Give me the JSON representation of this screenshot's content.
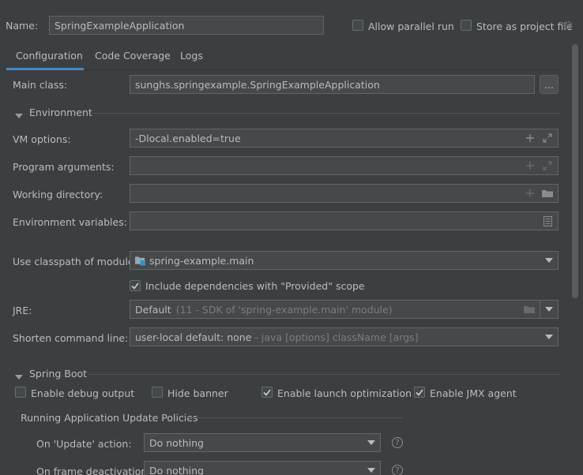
{
  "header": {
    "name_label": "Name:",
    "name_value": "SpringExampleApplication",
    "allow_parallel_label": "Allow parallel run",
    "store_project_label": "Store as project file"
  },
  "tabs": [
    {
      "label": "Configuration",
      "active": true
    },
    {
      "label": "Code Coverage",
      "active": false
    },
    {
      "label": "Logs",
      "active": false
    }
  ],
  "config": {
    "main_class_label": "Main class:",
    "main_class_value": "sunghs.springexample.SpringExampleApplication",
    "browse_label": "...",
    "environment_label": "Environment",
    "vm_options_label": "VM options:",
    "vm_options_value": "-Dlocal.enabled=true",
    "program_args_label": "Program arguments:",
    "program_args_value": "",
    "working_dir_label": "Working directory:",
    "working_dir_value": "",
    "env_vars_label": "Environment variables:",
    "env_vars_value": "",
    "classpath_label": "Use classpath of module:",
    "classpath_value": "spring-example.main",
    "include_deps_label": "Include dependencies with \"Provided\" scope",
    "include_deps_checked": true,
    "jre_label": "JRE:",
    "jre_value": "Default",
    "jre_hint": "(11 - SDK of 'spring-example.main' module)",
    "shorten_label": "Shorten command line:",
    "shorten_value": "user-local default: none",
    "shorten_hint": "- java [options] className [args]"
  },
  "spring_boot": {
    "section_label": "Spring Boot",
    "debug_output_label": "Enable debug output",
    "debug_output_checked": false,
    "hide_banner_label": "Hide banner",
    "hide_banner_checked": false,
    "launch_opt_label": "Enable launch optimization",
    "launch_opt_checked": true,
    "jmx_label": "Enable JMX agent",
    "jmx_checked": true,
    "policies_label": "Running Application Update Policies",
    "on_update_label": "On 'Update' action:",
    "on_update_value": "Do nothing",
    "on_frame_label": "On frame deactivation:",
    "on_frame_value": "Do nothing"
  },
  "colors": {
    "background": "#3c3f41",
    "field": "#45494a",
    "accent": "#4a88c7"
  }
}
